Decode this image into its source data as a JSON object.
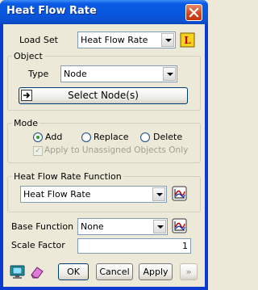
{
  "window": {
    "title": "Heat Flow Rate"
  },
  "load_set": {
    "label": "Load Set",
    "value": "Heat Flow Rate"
  },
  "object": {
    "group_title": "Object",
    "type_label": "Type",
    "type_value": "Node",
    "select_button": "Select Node(s)"
  },
  "mode": {
    "group_title": "Mode",
    "options": [
      "Add",
      "Replace",
      "Delete"
    ],
    "selected": "Add",
    "apply_unassigned": "Apply to Unassigned Objects Only"
  },
  "function": {
    "group_title": "Heat Flow Rate Function",
    "value": "Heat Flow Rate"
  },
  "base_function": {
    "label": "Base Function",
    "value": "None"
  },
  "scale_factor": {
    "label": "Scale Factor",
    "value": "1"
  },
  "buttons": {
    "ok": "OK",
    "cancel": "Cancel",
    "apply": "Apply",
    "more": "»"
  },
  "icons": {
    "load_set_icon": "L",
    "close": "×"
  },
  "colors": {
    "title_bar": "#0856dc",
    "face": "#ece9d8",
    "accent_yellow": "#f7d31c",
    "radio_dot": "#21a121"
  }
}
